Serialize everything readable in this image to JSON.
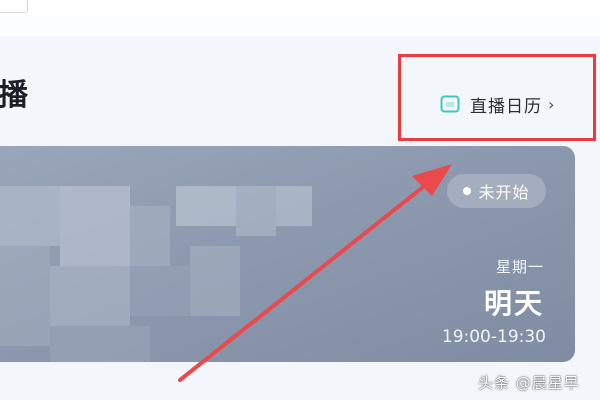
{
  "header": {
    "section_title": "播",
    "calendar_link": {
      "label": "直播日历",
      "chevron": "›",
      "icon": "calendar-icon"
    }
  },
  "live_card": {
    "status": "未开始",
    "weekday": "星期一",
    "day": "明天",
    "time_range": "19:00-19:30"
  },
  "watermark": {
    "text": "头条 @晨星早"
  },
  "colors": {
    "highlight": "#ea3b3f",
    "card_background": "#8c99ae",
    "calendar_icon": "#3ec9c0"
  }
}
